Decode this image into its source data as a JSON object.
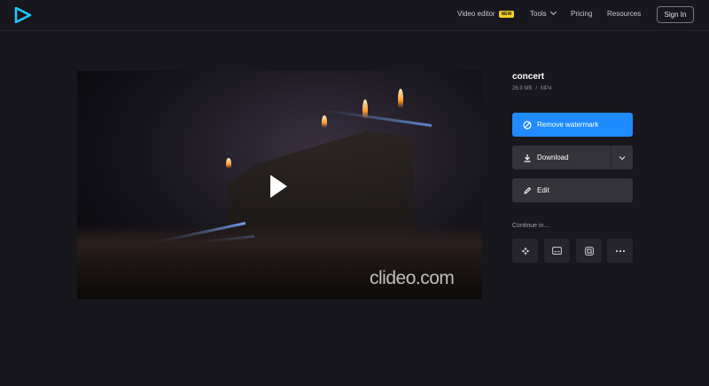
{
  "header": {
    "nav": [
      {
        "label": "Video editor",
        "badge": "NEW"
      },
      {
        "label": "Tools"
      },
      {
        "label": "Pricing"
      },
      {
        "label": "Resources"
      }
    ],
    "signin_label": "Sign In"
  },
  "player": {
    "watermark": "clideo.com",
    "play_icon": "play-icon"
  },
  "file": {
    "name": "concert",
    "size": "26.9 MB",
    "separator": "/",
    "format": "MP4"
  },
  "actions": {
    "remove_watermark": "Remove watermark",
    "download": "Download",
    "edit": "Edit"
  },
  "continue": {
    "label": "Continue in...",
    "tools": [
      "compress-tool-icon",
      "subtitles-tool-icon",
      "crop-tool-icon",
      "more-options-icon"
    ]
  },
  "colors": {
    "accent": "#1f8bff",
    "badge": "#f2d024",
    "background": "#18171d",
    "logo": "#1ec8ff"
  }
}
